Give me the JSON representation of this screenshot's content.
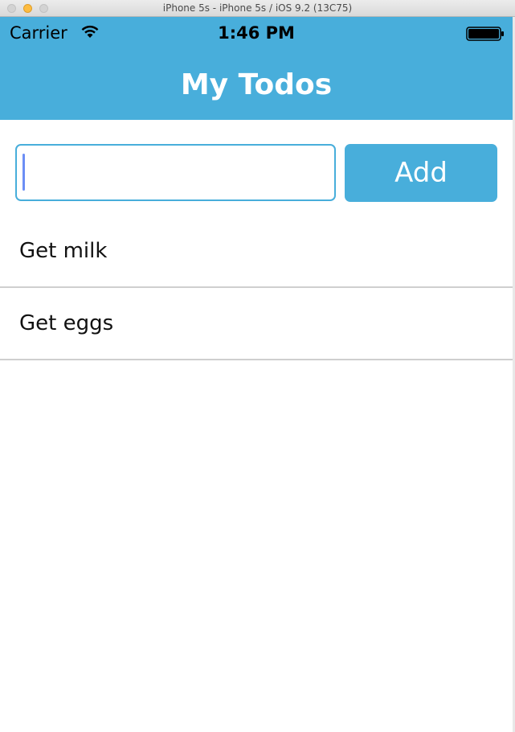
{
  "window": {
    "title": "iPhone 5s - iPhone 5s / iOS 9.2 (13C75)"
  },
  "status_bar": {
    "carrier": "Carrier",
    "time": "1:46 PM",
    "icons": [
      "wifi-icon",
      "battery-icon"
    ]
  },
  "nav": {
    "title": "My Todos"
  },
  "form": {
    "input_value": "",
    "input_placeholder": "",
    "add_label": "Add"
  },
  "todos": [
    {
      "label": "Get milk"
    },
    {
      "label": "Get eggs"
    }
  ],
  "colors": {
    "accent": "#48aedb",
    "caret": "#6c8ef5",
    "divider": "#cfcfcf",
    "text": "#111111"
  }
}
